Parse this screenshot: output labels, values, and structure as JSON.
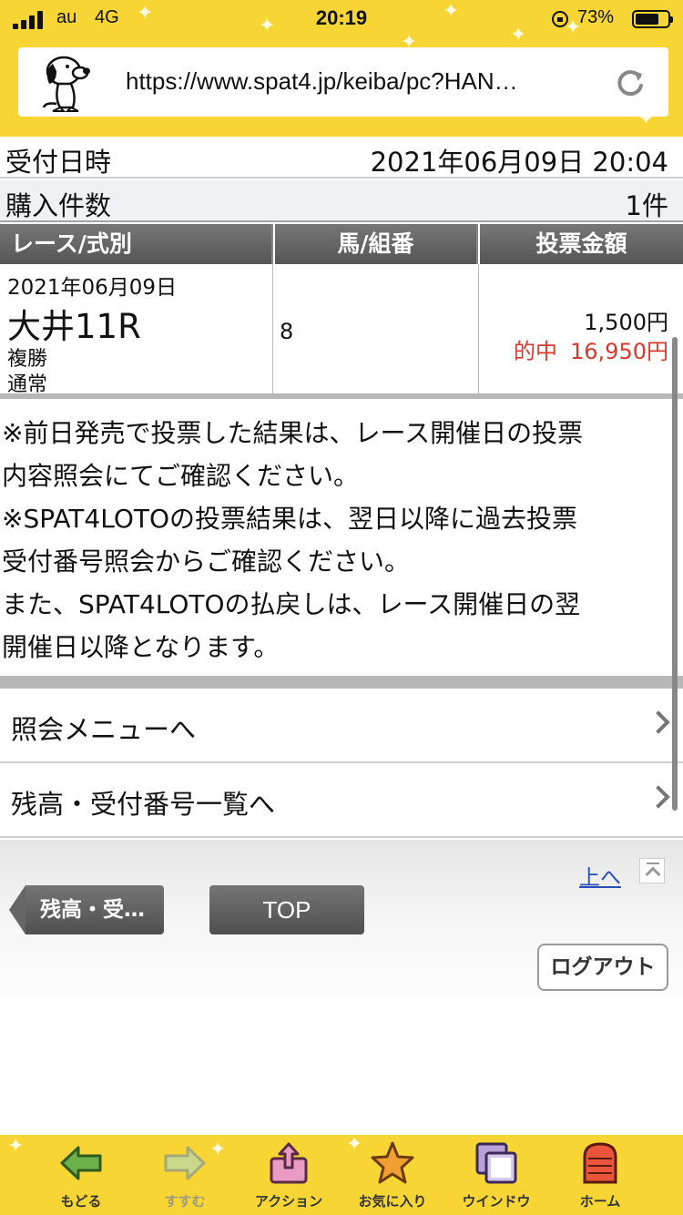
{
  "status_bar": {
    "carrier": "au",
    "network": "4G",
    "time": "20:19",
    "battery": "73%",
    "battery_level": 0.73
  },
  "browser": {
    "url": "https://www.spat4.jp/keiba/pc?HAN…"
  },
  "receipt": {
    "datetime_label": "受付日時",
    "datetime_value": "2021年06月09日 20:04",
    "count_label": "購入件数",
    "count_value": "1件"
  },
  "bet_table": {
    "headers": [
      "レース/式別",
      "馬/組番",
      "投票金額"
    ],
    "row": {
      "date": "2021年06月09日",
      "race": "大井11R",
      "bet_type": "複勝",
      "bet_mode": "通常",
      "horse": "8",
      "amount": "1,500円",
      "hit_label": "的中",
      "payout": "16,950円"
    }
  },
  "notes": [
    "※前日発売で投票した結果は、レース開催日の投票",
    "内容照会にてご確認ください。",
    "※SPAT4LOTOの投票結果は、翌日以降に過去投票",
    "受付番号照会からご確認ください。",
    "また、SPAT4LOTOの払戻しは、レース開催日の翌",
    "開催日以降となります。"
  ],
  "menu": {
    "items": [
      {
        "label": "照会メニューへ"
      },
      {
        "label": "残高・受付番号一覧へ"
      }
    ]
  },
  "footer": {
    "to_top": "上へ",
    "back_button": "残高・受…",
    "top_button": "TOP",
    "logout_button": "ログアウト"
  },
  "toolbar": {
    "back": "もどる",
    "forward": "すすむ",
    "action": "アクション",
    "favorites": "お気に入り",
    "window": "ウインドウ",
    "home": "ホーム"
  },
  "colors": {
    "chrome_yellow": "#f6d535",
    "hit_red": "#d43a2f",
    "link_blue": "#2a4dbb"
  }
}
